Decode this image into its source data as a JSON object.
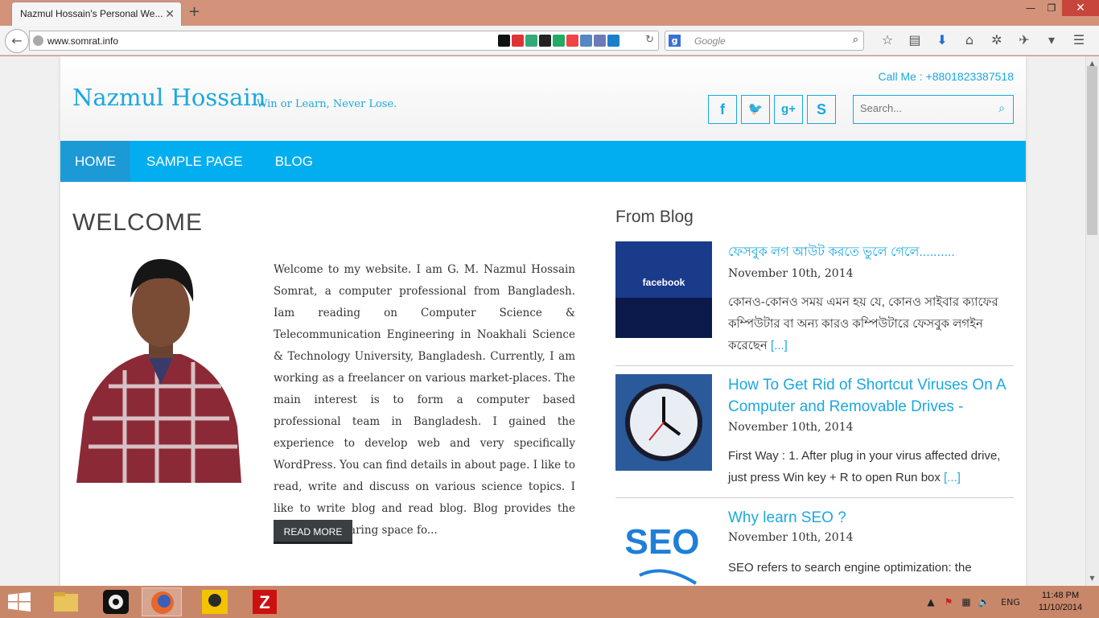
{
  "browser": {
    "tab_title": "Nazmul Hossain's Personal We...",
    "tab_close": "✕",
    "new_tab": "+",
    "url": "www.somrat.info",
    "search_placeholder": "Google",
    "window_buttons": [
      "—",
      "❐",
      "✕"
    ]
  },
  "site": {
    "title": "Nazmul Hossain",
    "tagline": "Win or Learn, Never Lose.",
    "call": "Call Me : +8801823387518",
    "social": [
      {
        "icon": "facebook-icon",
        "glyph": "f"
      },
      {
        "icon": "twitter-icon",
        "glyph": "🐦"
      },
      {
        "icon": "google-plus-icon",
        "glyph": "g+"
      },
      {
        "icon": "skype-icon",
        "glyph": "S"
      }
    ],
    "search_placeholder": "Search...",
    "menu": [
      "HOME",
      "SAMPLE PAGE",
      "BLOG"
    ]
  },
  "welcome": {
    "heading": "WELCOME",
    "text": "Welcome to my website.   I am G. M. Nazmul Hossain Somrat, a computer professional from Bangladesh. Iam reading on Computer Science & Telecommunication Engineering in Noakhali Science & Technology University, Bangladesh.  Currently, I am working as a freelancer on various market-places. The main interest is to form a computer based professional team in Bangladesh. I gained the experience to develop web and very specifically WordPress. You can find details in about page.   I like to read, write and discuss on various science topics. I like to write blog and read blog. Blog provides the knowledge sharing space fo...",
    "read_more": "READ MORE"
  },
  "blog": {
    "heading": "From Blog",
    "posts": [
      {
        "title": "ফেসবুক লগ আউট করতে ভুলে গেলে..........",
        "date": "November 10th, 2014",
        "excerpt": "কোনও-কোনও সময় এমন হয় যে, কোনও সাইবার ক্যাফের কম্পিউটার বা অন্য কারও কম্পিউটারে ফেসবুক লগইন করেছেন",
        "thumb_text": "facebook"
      },
      {
        "title": "How To Get Rid of Shortcut Viruses On A Computer and Removable Drives -",
        "date": "November 10th, 2014",
        "excerpt": "First Way :  1. After plug in your virus affected drive, just press Win key + R to open Run box"
      },
      {
        "title": "Why learn SEO ?",
        "date": "November 10th, 2014",
        "excerpt": "SEO refers to search engine optimization: the",
        "thumb_text": "SEO"
      }
    ],
    "more": "[...]"
  },
  "taskbar": {
    "lang": "ENG",
    "time": "11:48 PM",
    "date": "11/10/2014"
  }
}
